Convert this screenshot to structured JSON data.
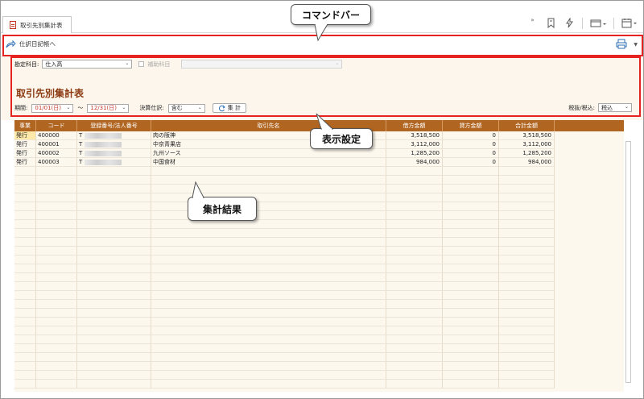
{
  "tab": {
    "label": "取引先別集計表"
  },
  "toolbar_icons": [
    "bookmark-icon",
    "lightning-icon",
    "window-layout-icon",
    "calendar-icon"
  ],
  "command_bar": {
    "journal_link": "仕訳日記帳へ",
    "print_icon": "printer-icon"
  },
  "settings": {
    "account_label": "勘定科目:",
    "account_value": "仕入高",
    "sub_account_label": "補助科目",
    "title": "取引先別集計表",
    "period_label": "期間:",
    "period_from": "01/01(日)",
    "period_sep": "〜",
    "period_to": "12/31(日)",
    "closing_label": "決算仕訳:",
    "closing_value": "含む",
    "calc_button": "集 計",
    "tax_label": "税抜/税込:",
    "tax_value": "税込"
  },
  "table": {
    "headers": [
      "事業",
      "コード",
      "登録番号/法人番号",
      "取引先名",
      "借方金額",
      "貸方金額",
      "合計金額"
    ],
    "rows": [
      {
        "biz": "発行",
        "code": "400000",
        "reg": "T",
        "name": "肉の阪神",
        "debit": "3,518,500",
        "credit": "0",
        "total": "3,518,500"
      },
      {
        "biz": "発行",
        "code": "400001",
        "reg": "T",
        "name": "中京青果店",
        "debit": "3,112,000",
        "credit": "0",
        "total": "3,112,000"
      },
      {
        "biz": "発行",
        "code": "400002",
        "reg": "T",
        "name": "九州ソース",
        "debit": "1,285,200",
        "credit": "0",
        "total": "1,285,200"
      },
      {
        "biz": "発行",
        "code": "400003",
        "reg": "T",
        "name": "中国食材",
        "debit": "984,000",
        "credit": "0",
        "total": "984,000"
      }
    ]
  },
  "callouts": {
    "command_bar": "コマンドバー",
    "display_settings": "表示設定",
    "results": "集計結果"
  },
  "colors": {
    "highlight": "#e52421",
    "header_bg": "#b06520",
    "title": "#8b3a12"
  }
}
